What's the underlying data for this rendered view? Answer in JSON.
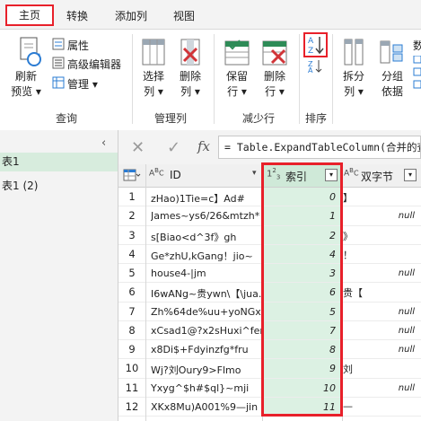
{
  "tabs": [
    "主页",
    "转换",
    "添加列",
    "视图"
  ],
  "ribbon": {
    "refresh_preview": [
      "刷新",
      "预览 ▾"
    ],
    "properties": "属性",
    "advanced_editor": "高级编辑器",
    "manage": "管理 ▾",
    "group_query": "查询",
    "choose_cols": [
      "选择",
      "列 ▾"
    ],
    "remove_cols": [
      "删除",
      "列 ▾"
    ],
    "group_manage_cols": "管理列",
    "keep_rows": [
      "保留",
      "行 ▾"
    ],
    "remove_rows": [
      "删除",
      "行 ▾"
    ],
    "group_reduce_rows": "减少行",
    "group_sort": "排序",
    "split_col": [
      "拆分",
      "列 ▾"
    ],
    "group_by": [
      "分组",
      "依据"
    ],
    "data_type_partial": "数"
  },
  "queries": [
    "表1",
    "表1 (2)"
  ],
  "formula": "= Table.ExpandTableColumn(合并的查",
  "columns": {
    "id_type": "A B C",
    "id": "ID",
    "idx_type": "1 2 3",
    "idx": "索引",
    "cn_type": "A B C",
    "cn": "双字节"
  },
  "rows": [
    {
      "n": "1",
      "id": "zHao)1Tie=c】Ad#",
      "idx": "0",
      "cn": "】"
    },
    {
      "n": "2",
      "id": "James~ys6/26&mtzh*",
      "idx": "1",
      "cn": "null"
    },
    {
      "n": "3",
      "id": "s[Biao<d^3f》gh",
      "idx": "2",
      "cn": "》"
    },
    {
      "n": "4",
      "id": "Ge*zhU,kGang！jio~",
      "idx": "4",
      "cn": "！"
    },
    {
      "n": "5",
      "id": "house4-|jm",
      "idx": "3",
      "cn": "null"
    },
    {
      "n": "6",
      "id": "I6wANg~贵ywn\\【\\jua...",
      "idx": "6",
      "cn": "贵【"
    },
    {
      "n": "7",
      "id": "Zh%64de%uu+yoNGxc",
      "idx": "5",
      "cn": "null"
    },
    {
      "n": "8",
      "id": "xCsad1@?x2sHuxi^fer",
      "idx": "7",
      "cn": "null"
    },
    {
      "n": "9",
      "id": "x8Di$+Fdyinzfg*fru",
      "idx": "8",
      "cn": "null"
    },
    {
      "n": "10",
      "id": "Wj?刘Oury9>Flmo",
      "idx": "9",
      "cn": "刘"
    },
    {
      "n": "11",
      "id": "Yxyg^$h#$ql}~mji",
      "idx": "10",
      "cn": "null"
    },
    {
      "n": "12",
      "id": "XKx8Mu)A001%9—jin",
      "idx": "11",
      "cn": "—"
    }
  ]
}
